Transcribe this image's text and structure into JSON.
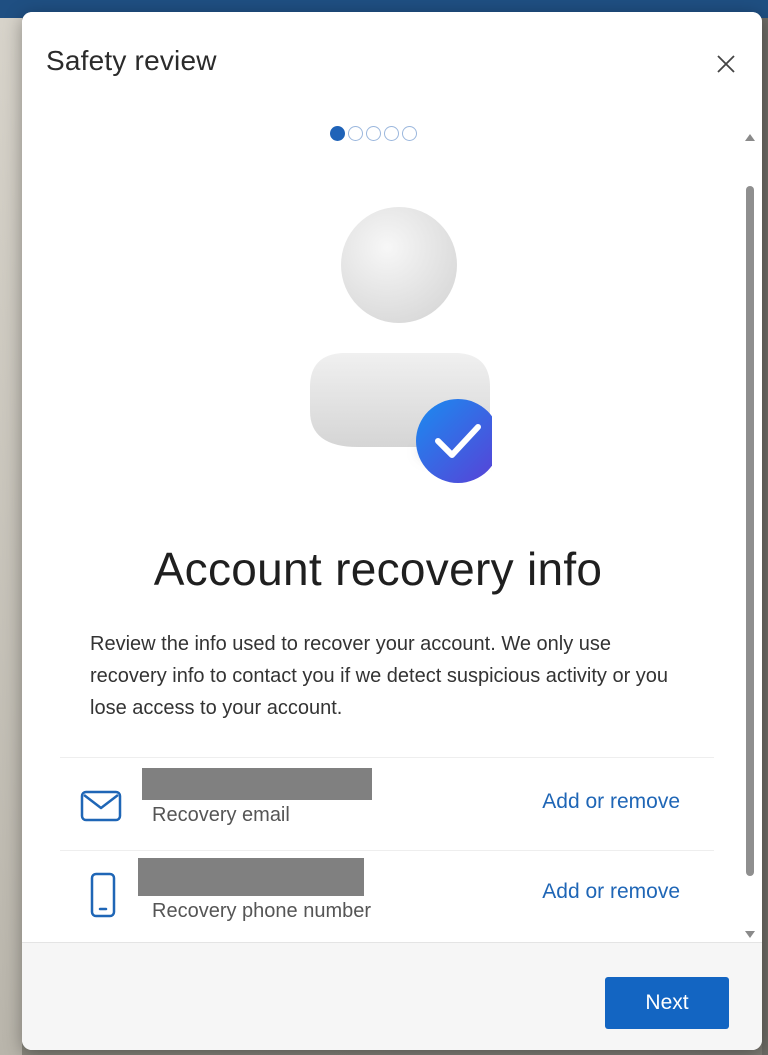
{
  "dialog": {
    "title": "Safety review"
  },
  "progress": {
    "total_steps": 5,
    "current_step": 1
  },
  "main": {
    "heading": "Account recovery info",
    "description": "Review the info used to recover your account. We only use recovery info to contact you if we detect suspicious activity or you lose access to your account."
  },
  "recovery_items": [
    {
      "icon": "mail-icon",
      "label": "Recovery email",
      "action": "Add or remove"
    },
    {
      "icon": "phone-icon",
      "label": "Recovery phone number",
      "action": "Add or remove"
    }
  ],
  "footer": {
    "next_label": "Next"
  },
  "colors": {
    "accent": "#1365c2",
    "link": "#1f66b6",
    "badge_gradient_start": "#1a8cf0",
    "badge_gradient_end": "#5a3fd6"
  }
}
